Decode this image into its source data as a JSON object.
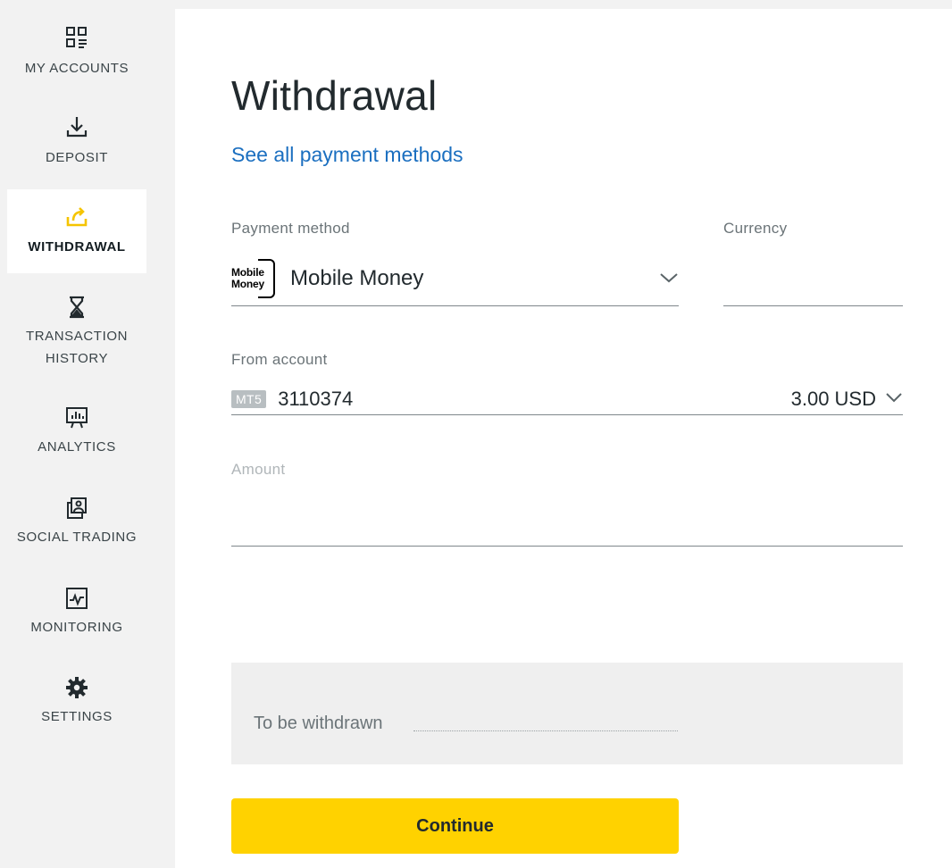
{
  "sidebar": {
    "items": [
      {
        "label": "MY ACCOUNTS",
        "icon": "accounts-grid-icon"
      },
      {
        "label": "DEPOSIT",
        "icon": "download-icon"
      },
      {
        "label": "WITHDRAWAL",
        "icon": "upload-share-icon",
        "active": true
      },
      {
        "label": "TRANSACTION\nHISTORY",
        "icon": "hourglass-icon"
      },
      {
        "label": "ANALYTICS",
        "icon": "presentation-chart-icon"
      },
      {
        "label": "SOCIAL TRADING",
        "icon": "social-trading-icon"
      },
      {
        "label": "MONITORING",
        "icon": "pulse-monitor-icon"
      },
      {
        "label": "SETTINGS",
        "icon": "gear-icon"
      }
    ]
  },
  "main": {
    "title": "Withdrawal",
    "see_all_link": "See all payment methods",
    "payment_method": {
      "label": "Payment method",
      "logo_line1": "Mobile",
      "logo_line2": "Money",
      "value": "Mobile Money"
    },
    "currency": {
      "label": "Currency",
      "value": ""
    },
    "from_account": {
      "label": "From account",
      "badge": "MT5",
      "number": "3110374",
      "balance": "3.00 USD"
    },
    "amount": {
      "label": "Amount",
      "value": ""
    },
    "summary": {
      "label": "To be withdrawn"
    },
    "continue_label": "Continue"
  },
  "colors": {
    "accent": "#ffd200",
    "link": "#1b6fc0",
    "sidebar_bg": "#f2f2f2",
    "active_icon": "#f5c400"
  }
}
